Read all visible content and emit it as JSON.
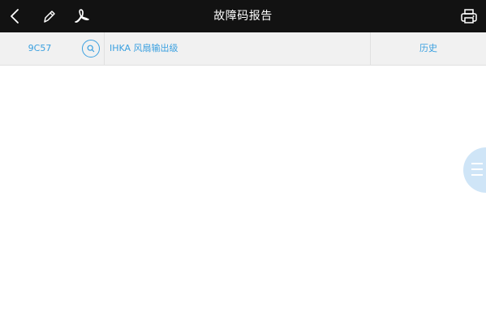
{
  "header": {
    "title": "故障码报告",
    "icons": {
      "back": "back-chevron-icon",
      "edit": "pen-icon",
      "pdf": "pdf-icon",
      "print": "printer-icon"
    }
  },
  "fault_row": {
    "code": "9C57",
    "search_icon": "search-icon",
    "description": "IHKA 风扇输出级",
    "status": "历史"
  },
  "floating_button": {
    "icon": "menu-icon"
  },
  "colors": {
    "topbar": "#121212",
    "accent": "#3aa0e0",
    "row_bg": "#f1f1f1",
    "floating_button": "#cfe5f7"
  }
}
